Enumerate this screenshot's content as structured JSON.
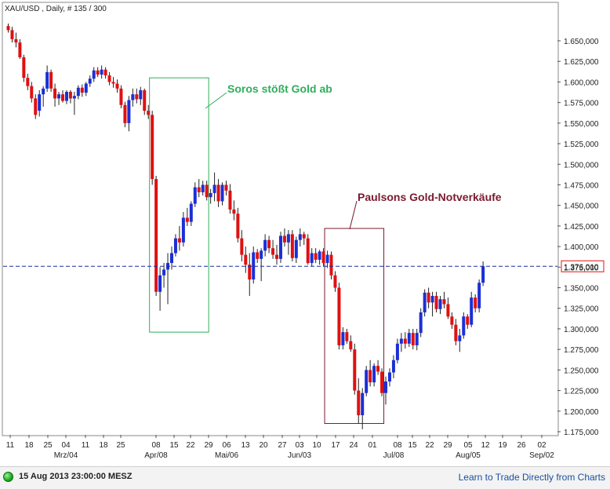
{
  "header": {
    "title": "XAU/USD , Daily, # 135 / 300"
  },
  "footer": {
    "timestamp": "15 Aug 2013 23:00:00 MESZ",
    "link": "Learn to Trade Directly from Charts"
  },
  "colors": {
    "up": "#1b2fd6",
    "down": "#e01010",
    "soros_box": "#2fae5a",
    "paulson_box": "#7a1a2e",
    "price_line": "#1a2aa0",
    "frame": "#8a8a8a"
  },
  "chart_data": {
    "type": "candlestick",
    "symbol": "XAU/USD",
    "interval": "Daily",
    "ylim": [
      1170,
      1680
    ],
    "y_ticks": [
      1175,
      1200,
      1225,
      1250,
      1275,
      1300,
      1325,
      1350,
      1375,
      1400,
      1425,
      1450,
      1475,
      1500,
      1525,
      1550,
      1575,
      1600,
      1625,
      1650
    ],
    "y_tick_labels": [
      "1.175,000",
      "1.200,000",
      "1.225,000",
      "1.250,000",
      "1.275,000",
      "1.300,000",
      "1.325,000",
      "1.350,000",
      "1.375,000",
      "1.400,000",
      "1.425,000",
      "1.450,000",
      "1.475,000",
      "1.500,000",
      "1.525,000",
      "1.550,000",
      "1.575,000",
      "1.600,000",
      "1.625,000",
      "1.650,000"
    ],
    "x_day_labels": [
      "11",
      "18",
      "25",
      "04",
      "11",
      "18",
      "25",
      "08",
      "15",
      "22",
      "29",
      "06",
      "13",
      "20",
      "27",
      "03",
      "10",
      "17",
      "24",
      "01",
      "08",
      "15",
      "22",
      "29",
      "05",
      "12",
      "19",
      "26",
      "02"
    ],
    "x_month_labels": [
      {
        "label": "Mrz/04",
        "under": "04"
      },
      {
        "label": "Apr/08",
        "under": "08"
      },
      {
        "label": "Mai/06",
        "under": "06"
      },
      {
        "label": "Jun/03",
        "under": "03"
      },
      {
        "label": "Jul/08",
        "under": "08"
      },
      {
        "label": "Aug/05",
        "under": "05"
      },
      {
        "label": "Sep/02",
        "under": "02"
      }
    ],
    "candles": [
      [
        1668,
        1671,
        1660,
        1663
      ],
      [
        1663,
        1667,
        1648,
        1652
      ],
      [
        1652,
        1660,
        1642,
        1648
      ],
      [
        1648,
        1652,
        1628,
        1630
      ],
      [
        1630,
        1633,
        1600,
        1605
      ],
      [
        1605,
        1610,
        1590,
        1595
      ],
      [
        1595,
        1600,
        1575,
        1580
      ],
      [
        1580,
        1585,
        1555,
        1560
      ],
      [
        1565,
        1590,
        1558,
        1585
      ],
      [
        1585,
        1595,
        1570,
        1592
      ],
      [
        1592,
        1620,
        1588,
        1612
      ],
      [
        1612,
        1615,
        1588,
        1592
      ],
      [
        1592,
        1598,
        1570,
        1580
      ],
      [
        1580,
        1588,
        1572,
        1585
      ],
      [
        1585,
        1590,
        1575,
        1577
      ],
      [
        1577,
        1590,
        1573,
        1588
      ],
      [
        1588,
        1590,
        1574,
        1580
      ],
      [
        1580,
        1588,
        1560,
        1583
      ],
      [
        1583,
        1596,
        1579,
        1593
      ],
      [
        1593,
        1597,
        1582,
        1587
      ],
      [
        1587,
        1600,
        1583,
        1598
      ],
      [
        1598,
        1608,
        1594,
        1604
      ],
      [
        1604,
        1618,
        1600,
        1614
      ],
      [
        1614,
        1618,
        1606,
        1609
      ],
      [
        1609,
        1620,
        1604,
        1615
      ],
      [
        1615,
        1618,
        1604,
        1608
      ],
      [
        1608,
        1612,
        1596,
        1600
      ],
      [
        1600,
        1606,
        1593,
        1598
      ],
      [
        1598,
        1603,
        1587,
        1592
      ],
      [
        1592,
        1596,
        1568,
        1572
      ],
      [
        1572,
        1576,
        1545,
        1550
      ],
      [
        1550,
        1583,
        1540,
        1578
      ],
      [
        1578,
        1592,
        1570,
        1585
      ],
      [
        1585,
        1592,
        1574,
        1579
      ],
      [
        1579,
        1594,
        1572,
        1590
      ],
      [
        1590,
        1592,
        1560,
        1565
      ],
      [
        1565,
        1572,
        1555,
        1560
      ],
      [
        1560,
        1565,
        1475,
        1482
      ],
      [
        1482,
        1486,
        1340,
        1345
      ],
      [
        1345,
        1375,
        1322,
        1365
      ],
      [
        1365,
        1380,
        1350,
        1372
      ],
      [
        1372,
        1392,
        1330,
        1380
      ],
      [
        1380,
        1400,
        1372,
        1392
      ],
      [
        1392,
        1415,
        1388,
        1410
      ],
      [
        1410,
        1425,
        1395,
        1405
      ],
      [
        1405,
        1442,
        1400,
        1435
      ],
      [
        1435,
        1447,
        1425,
        1430
      ],
      [
        1430,
        1455,
        1425,
        1452
      ],
      [
        1452,
        1478,
        1448,
        1472
      ],
      [
        1472,
        1482,
        1460,
        1466
      ],
      [
        1466,
        1480,
        1462,
        1475
      ],
      [
        1475,
        1480,
        1456,
        1460
      ],
      [
        1460,
        1470,
        1452,
        1465
      ],
      [
        1465,
        1490,
        1455,
        1475
      ],
      [
        1475,
        1482,
        1448,
        1455
      ],
      [
        1455,
        1478,
        1450,
        1475
      ],
      [
        1475,
        1480,
        1462,
        1468
      ],
      [
        1468,
        1476,
        1440,
        1445
      ],
      [
        1445,
        1456,
        1432,
        1440
      ],
      [
        1440,
        1447,
        1405,
        1410
      ],
      [
        1410,
        1420,
        1382,
        1390
      ],
      [
        1390,
        1400,
        1368,
        1378
      ],
      [
        1378,
        1392,
        1340,
        1360
      ],
      [
        1360,
        1400,
        1355,
        1393
      ],
      [
        1393,
        1397,
        1380,
        1385
      ],
      [
        1385,
        1398,
        1358,
        1395
      ],
      [
        1395,
        1415,
        1388,
        1408
      ],
      [
        1408,
        1413,
        1392,
        1398
      ],
      [
        1398,
        1408,
        1385,
        1390
      ],
      [
        1390,
        1402,
        1378,
        1385
      ],
      [
        1385,
        1418,
        1380,
        1413
      ],
      [
        1413,
        1422,
        1400,
        1405
      ],
      [
        1405,
        1420,
        1390,
        1415
      ],
      [
        1415,
        1420,
        1382,
        1386
      ],
      [
        1386,
        1412,
        1380,
        1408
      ],
      [
        1408,
        1422,
        1400,
        1415
      ],
      [
        1415,
        1418,
        1402,
        1410
      ],
      [
        1410,
        1415,
        1378,
        1380
      ],
      [
        1380,
        1398,
        1376,
        1392
      ],
      [
        1392,
        1398,
        1380,
        1384
      ],
      [
        1384,
        1396,
        1378,
        1394
      ],
      [
        1394,
        1398,
        1376,
        1380
      ],
      [
        1380,
        1395,
        1374,
        1390
      ],
      [
        1390,
        1394,
        1360,
        1365
      ],
      [
        1365,
        1370,
        1345,
        1350
      ],
      [
        1350,
        1356,
        1275,
        1280
      ],
      [
        1280,
        1302,
        1275,
        1296
      ],
      [
        1296,
        1300,
        1282,
        1285
      ],
      [
        1285,
        1292,
        1272,
        1275
      ],
      [
        1275,
        1282,
        1220,
        1225
      ],
      [
        1225,
        1240,
        1185,
        1195
      ],
      [
        1195,
        1228,
        1178,
        1222
      ],
      [
        1222,
        1255,
        1218,
        1250
      ],
      [
        1250,
        1262,
        1230,
        1235
      ],
      [
        1235,
        1258,
        1230,
        1255
      ],
      [
        1255,
        1262,
        1244,
        1248
      ],
      [
        1248,
        1252,
        1218,
        1222
      ],
      [
        1222,
        1242,
        1208,
        1236
      ],
      [
        1236,
        1252,
        1230,
        1247
      ],
      [
        1247,
        1268,
        1240,
        1262
      ],
      [
        1262,
        1288,
        1258,
        1282
      ],
      [
        1282,
        1295,
        1272,
        1288
      ],
      [
        1288,
        1296,
        1276,
        1282
      ],
      [
        1282,
        1300,
        1278,
        1295
      ],
      [
        1295,
        1300,
        1275,
        1280
      ],
      [
        1280,
        1300,
        1274,
        1295
      ],
      [
        1295,
        1325,
        1290,
        1320
      ],
      [
        1320,
        1348,
        1315,
        1344
      ],
      [
        1344,
        1350,
        1325,
        1332
      ],
      [
        1332,
        1345,
        1315,
        1340
      ],
      [
        1340,
        1345,
        1320,
        1324
      ],
      [
        1324,
        1340,
        1318,
        1336
      ],
      [
        1336,
        1345,
        1325,
        1330
      ],
      [
        1330,
        1338,
        1312,
        1315
      ],
      [
        1315,
        1320,
        1300,
        1305
      ],
      [
        1305,
        1312,
        1280,
        1285
      ],
      [
        1285,
        1300,
        1272,
        1292
      ],
      [
        1292,
        1320,
        1288,
        1315
      ],
      [
        1315,
        1318,
        1300,
        1305
      ],
      [
        1305,
        1345,
        1302,
        1338
      ],
      [
        1338,
        1342,
        1320,
        1325
      ],
      [
        1325,
        1360,
        1320,
        1356
      ],
      [
        1356,
        1382,
        1352,
        1376
      ]
    ],
    "current_price": 1376.01,
    "current_price_label": "1.376,010",
    "annotations": [
      {
        "text": "Soros stößt Gold ab",
        "color": "#2fae5a",
        "range_days": [
          "08",
          "29"
        ],
        "price_range": [
          1296,
          1605
        ]
      },
      {
        "text": "Paulsons Gold-Notverkäufe",
        "color": "#7a1a2e",
        "range_days": [
          "10",
          "01"
        ],
        "price_range": [
          1185,
          1422
        ]
      }
    ],
    "grid": false
  }
}
